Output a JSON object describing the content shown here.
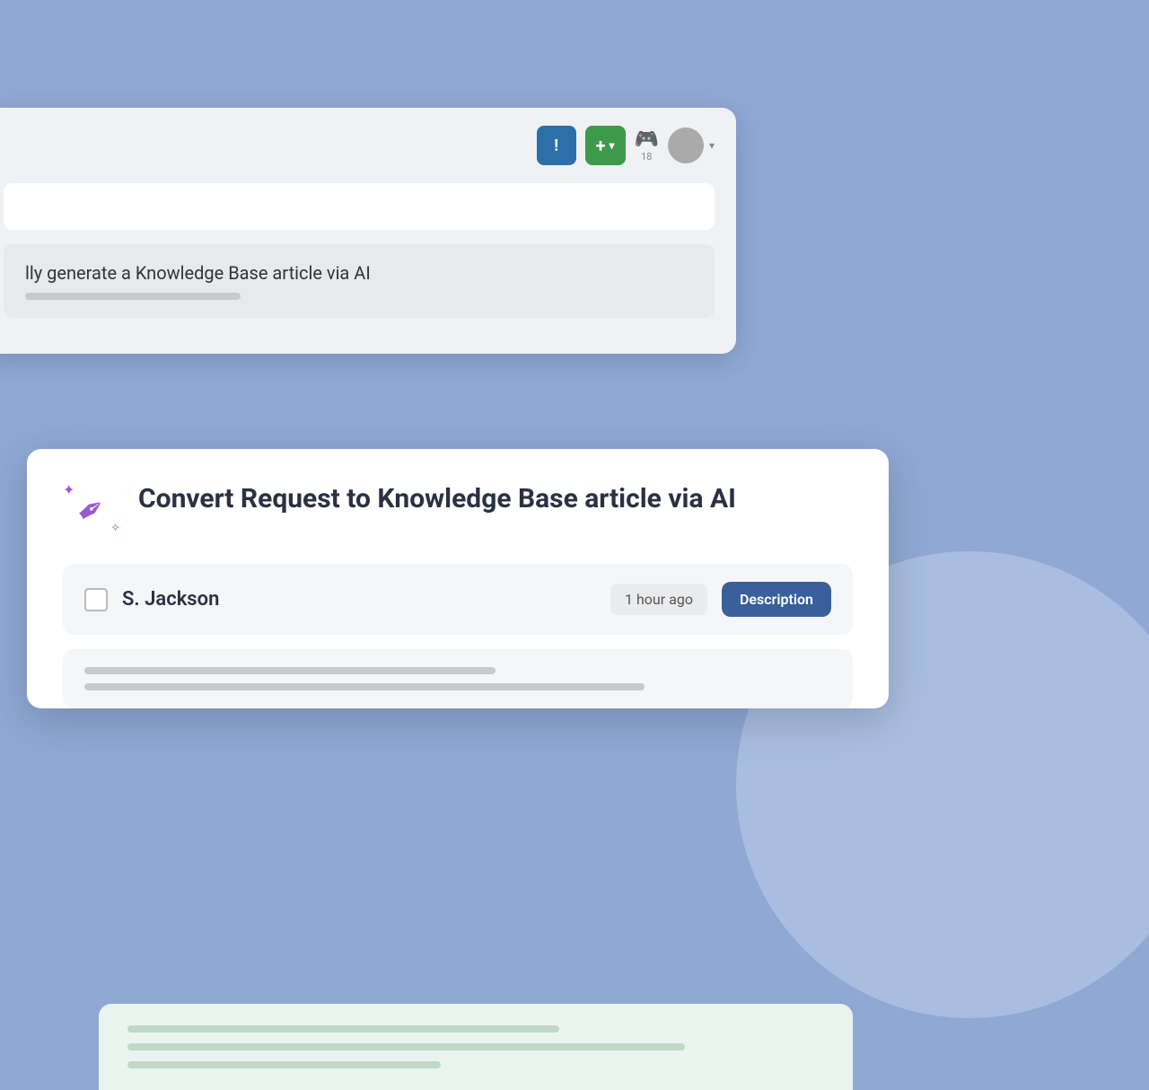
{
  "background": {
    "color": "#8fa8d4"
  },
  "toolbar": {
    "info_btn_icon": "!",
    "add_btn_label": "+",
    "add_btn_arrow": "▾",
    "gamepad_count": "18",
    "avatar_arrow": "▾"
  },
  "back_card": {
    "row_title": "lly generate a Knowledge Base article via AI"
  },
  "front_card": {
    "title": "Convert Request to Knowledge Base article via AI",
    "item": {
      "name": "S. Jackson",
      "time": "1 hour ago",
      "description_btn": "Description"
    }
  },
  "icons": {
    "wand": "✏",
    "sparkle_large": "✦",
    "sparkle_small": "✧",
    "checkbox_empty": ""
  }
}
